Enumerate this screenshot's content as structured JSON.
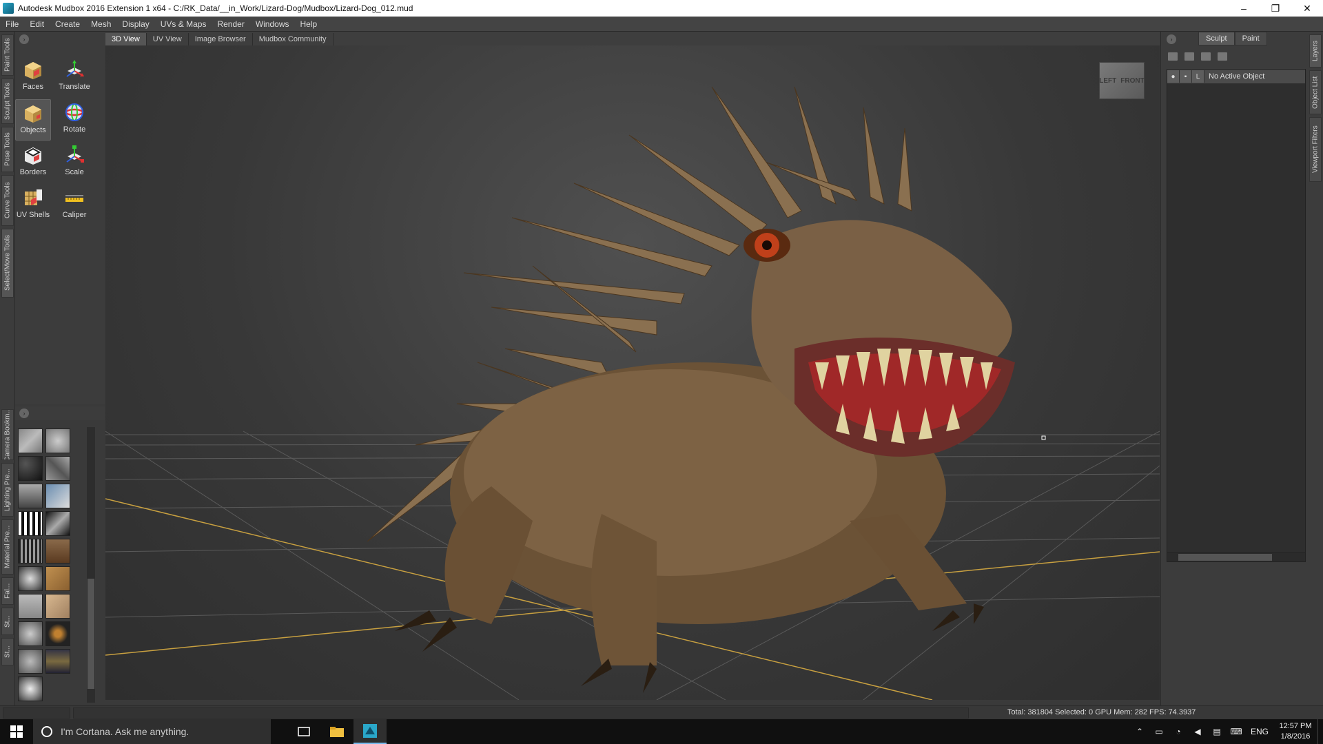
{
  "window": {
    "title": "Autodesk Mudbox 2016 Extension 1 x64 - C:/RK_Data/__in_Work/Lizard-Dog/Mudbox/Lizard-Dog_012.mud",
    "minimize": "–",
    "maximize": "❐",
    "close": "✕"
  },
  "menu": [
    "File",
    "Edit",
    "Create",
    "Mesh",
    "Display",
    "UVs & Maps",
    "Render",
    "Windows",
    "Help"
  ],
  "left_tabs": [
    "Paint Tools",
    "Sculpt Tools",
    "Pose Tools",
    "Curve Tools",
    "Select/Move Tools"
  ],
  "tray_tabs": [
    "Camera Bookm...",
    "Lighting Pre...",
    "Material Pre...",
    "Fal...",
    "St...",
    "St..."
  ],
  "tools": [
    "Faces",
    "Translate",
    "Objects",
    "Rotate",
    "Borders",
    "Scale",
    "UV Shells",
    "Caliper"
  ],
  "view_tabs": [
    "3D View",
    "UV View",
    "Image Browser",
    "Mudbox Community"
  ],
  "viewcube": {
    "left": "LEFT",
    "front": "FRONT"
  },
  "right_panel": {
    "modes": [
      "Sculpt",
      "Paint"
    ],
    "layer_row_flag": "L",
    "layer_row_name": "No Active Object"
  },
  "right_tabs": [
    "Layers",
    "Object List",
    "Viewport Filters"
  ],
  "status": {
    "text": "Total: 381804  Selected: 0 GPU Mem: 282  FPS: 74.3937"
  },
  "taskbar": {
    "cortana": "I'm Cortana. Ask me anything.",
    "lang": "ENG",
    "time": "12:57 PM",
    "date": "1/8/2016"
  }
}
